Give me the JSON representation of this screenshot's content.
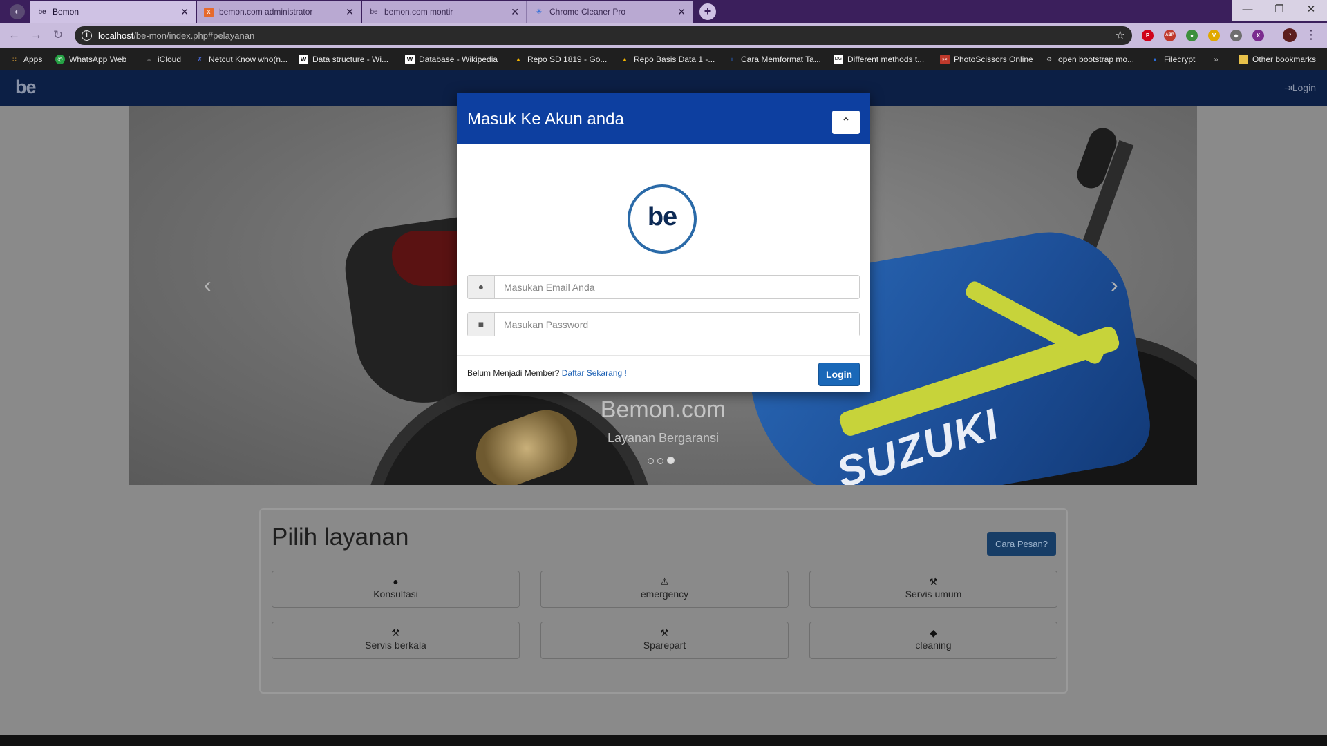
{
  "browser": {
    "window_icon": "◐",
    "tabs": [
      {
        "title": "Bemon",
        "favicon": "be",
        "active": true
      },
      {
        "title": "bemon.com administrator",
        "favicon": "x",
        "active": false
      },
      {
        "title": "bemon.com montir",
        "favicon": "be",
        "active": false
      },
      {
        "title": "Chrome Cleaner Pro",
        "favicon": "✳",
        "active": false
      }
    ],
    "tab_close": "✕",
    "new_tab": "+",
    "window_controls": {
      "minimize": "—",
      "restore": "❐",
      "close": "✕"
    },
    "nav": {
      "back": "←",
      "forward": "→",
      "reload": "↻"
    },
    "address": {
      "host": "localhost",
      "path": "/be-mon/index.php#pelayanan",
      "info": "i",
      "star": "☆"
    },
    "extensions": [
      {
        "name": "pinterest-icon",
        "label": "P",
        "color": "#d0021b"
      },
      {
        "name": "adblock-icon",
        "label": "ABP",
        "color": "#c0392b"
      },
      {
        "name": "green-globe-icon",
        "label": "●",
        "color": "#3c8f3c"
      },
      {
        "name": "vimium-icon",
        "label": "V",
        "color": "#e0a800"
      },
      {
        "name": "eraser-icon",
        "label": "◆",
        "color": "#6e6e6e"
      },
      {
        "name": "purple-x-icon",
        "label": "X",
        "color": "#7b2c8f"
      },
      {
        "name": "profile-icon",
        "label": "◑",
        "color": "#5c1e1e"
      }
    ],
    "menu": "⋮",
    "bookmarks": [
      {
        "label": "Apps",
        "icon": "∷",
        "color": "#e8a838"
      },
      {
        "label": "WhatsApp Web",
        "icon": "✆",
        "color": "#25a244"
      },
      {
        "label": "iCloud",
        "icon": "☁",
        "color": "#555555"
      },
      {
        "label": "Netcut Know who(n...",
        "icon": "✗",
        "color": "#4a6bd8"
      },
      {
        "label": "Data structure - Wi...",
        "icon": "W",
        "color": "#ffffff"
      },
      {
        "label": "Database - Wikipedia",
        "icon": "W",
        "color": "#ffffff"
      },
      {
        "label": "Repo SD 1819 - Go...",
        "icon": "▲",
        "color": "#f4b400"
      },
      {
        "label": "Repo Basis Data 1 -...",
        "icon": "▲",
        "color": "#f4b400"
      },
      {
        "label": "Cara Memformat Ta...",
        "icon": "i",
        "color": "#2a6bd8"
      },
      {
        "label": "Different methods t...",
        "icon": "DG",
        "color": "#ffffff"
      },
      {
        "label": "PhotoScissors Online",
        "icon": "✂",
        "color": "#c0392b"
      },
      {
        "label": "open bootstrap mo...",
        "icon": "⚙",
        "color": "#bbbbbb"
      },
      {
        "label": "Filecrypt",
        "icon": "●",
        "color": "#2a6bd8"
      }
    ],
    "more_bookmarks": "»",
    "other_bookmarks": "Other bookmarks"
  },
  "site": {
    "brand": "be",
    "login_label": "Login",
    "login_icon": "⇥",
    "carousel": {
      "title": "Bemon.com",
      "subtitle": "Layanan Bergaransi",
      "prev": "‹",
      "next": "›",
      "slides": 3,
      "active_slide": 3,
      "bike_text": "SUZUKI"
    },
    "services": {
      "title": "Pilih layanan",
      "howto": "Cara Pesan?",
      "items": [
        {
          "label": "Konsultasi",
          "icon": "●"
        },
        {
          "label": "emergency",
          "icon": "⚠"
        },
        {
          "label": "Servis umum",
          "icon": "⚒"
        },
        {
          "label": "Servis berkala",
          "icon": "⚒"
        },
        {
          "label": "Sparepart",
          "icon": "⚒"
        },
        {
          "label": "cleaning",
          "icon": "◆"
        }
      ]
    }
  },
  "modal": {
    "title": "Masuk Ke Akun anda",
    "toggle": "⌃",
    "logo": "be",
    "email_placeholder": "Masukan Email Anda",
    "password_placeholder": "Masukan Password",
    "user_icon": "●",
    "lock_icon": "■",
    "footer_text": "Belum Menjadi Member?",
    "footer_link": "Daftar Sekarang !",
    "login_button": "Login"
  },
  "colors": {
    "modal_header": "#0d3fa0",
    "navbar": "#0c1f45",
    "login_button": "#1a68b8",
    "tabstrip": "#3b1f5c"
  }
}
